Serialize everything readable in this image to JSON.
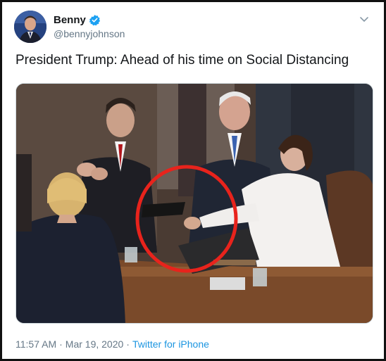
{
  "author": {
    "display_name": "Benny",
    "handle": "@bennyjohnson",
    "verified": true
  },
  "tweet": {
    "text": "President Trump: Ahead of his time on Social Distancing"
  },
  "meta": {
    "time": "11:57 AM",
    "separator": "·",
    "date": "Mar 19, 2020",
    "source": "Twitter for iPhone"
  },
  "icons": {
    "verified": "verified-badge-icon",
    "menu": "chevron-down-icon"
  },
  "colors": {
    "verified_blue": "#1da1f2",
    "link_blue": "#1b95e0",
    "annotation_red": "#e8231c",
    "secondary_text": "#657786"
  }
}
